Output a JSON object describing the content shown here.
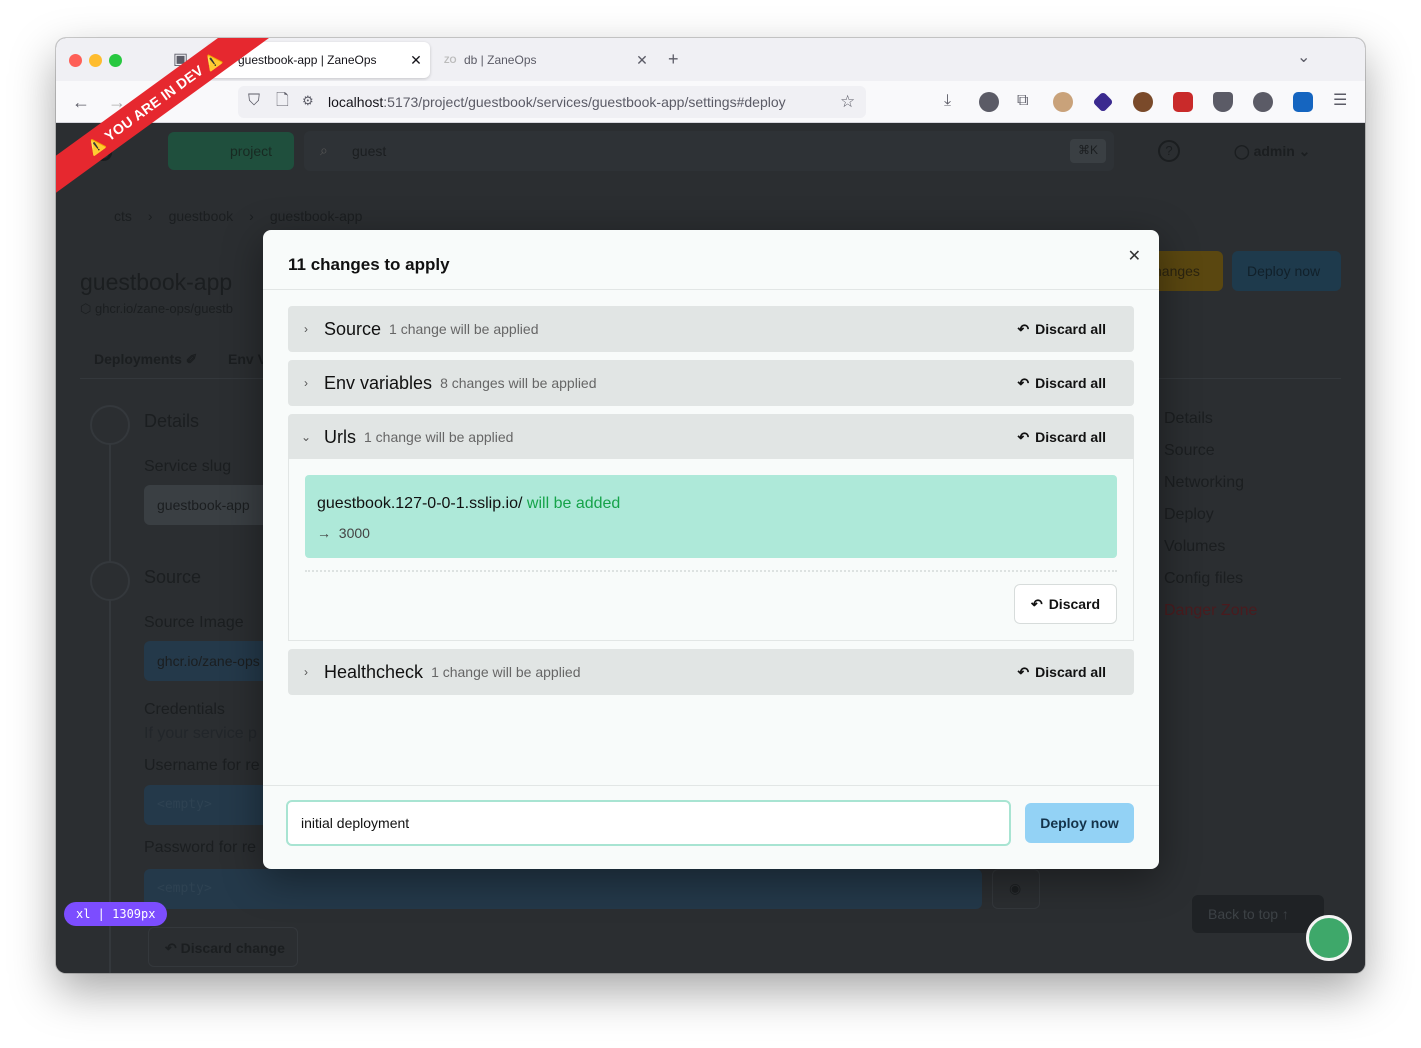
{
  "browser": {
    "tabs": [
      {
        "label": "guestbook-app | ZaneOps",
        "active": true
      },
      {
        "label": "db | ZaneOps",
        "active": false
      }
    ],
    "url_host": "localhost",
    "url_path": ":5173/project/guestbook/services/guestbook-app/settings#deploy"
  },
  "background": {
    "logo": "ZO",
    "create_button": "project",
    "search_value": "guest",
    "shortcut": "⌘K",
    "user": "admin",
    "breadcrumb": [
      "cts",
      "guestbook",
      "guestbook-app"
    ],
    "service_name": "guestbook-app",
    "image": "ghcr.io/zane-ops/guestb",
    "header_buttons": [
      "hanges",
      "Deploy now"
    ],
    "tabs": [
      "Deployments",
      "Env V"
    ],
    "sections": {
      "details": "Details",
      "service_slug_label": "Service slug",
      "service_slug_value": "guestbook-app",
      "source": "Source",
      "source_image_label": "Source Image",
      "source_image_value": "ghcr.io/zane-ops",
      "credentials": "Credentials",
      "credentials_hint": "If your service p",
      "username_label": "Username for re",
      "username_placeholder": "<empty>",
      "password_label": "Password for re",
      "password_placeholder": "<empty>",
      "discard_change": "Discard change"
    },
    "side_nav": [
      "Details",
      "Source",
      "Networking",
      "Deploy",
      "Volumes",
      "Config files",
      "Danger Zone"
    ],
    "back_to_top": "Back to top",
    "dev_ribbon": "⚠️ YOU ARE IN DEV ⚠️",
    "breakpoint_badge": "xl | 1309px"
  },
  "modal": {
    "title": "11 changes to apply",
    "sections": [
      {
        "title": "Source",
        "subtitle": "1 change will be applied",
        "action": "Discard all"
      },
      {
        "title": "Env variables",
        "subtitle": "8 changes will be applied",
        "action": "Discard all"
      },
      {
        "title": "Urls",
        "subtitle": "1 change will be applied",
        "action": "Discard all"
      },
      {
        "title": "Healthcheck",
        "subtitle": "1 change will be applied",
        "action": "Discard all"
      }
    ],
    "url_change": {
      "url": "guestbook.127-0-0-1.sslip.io/",
      "status": "will be added",
      "port": "3000",
      "discard": "Discard"
    },
    "commit_message": "initial deployment",
    "deploy_button": "Deploy now"
  },
  "colors": {
    "accent_green": "#16a34a",
    "added_bg": "#aee9d9",
    "deploy_btn": "#93d2f5",
    "ribbon": "#e6282f"
  }
}
